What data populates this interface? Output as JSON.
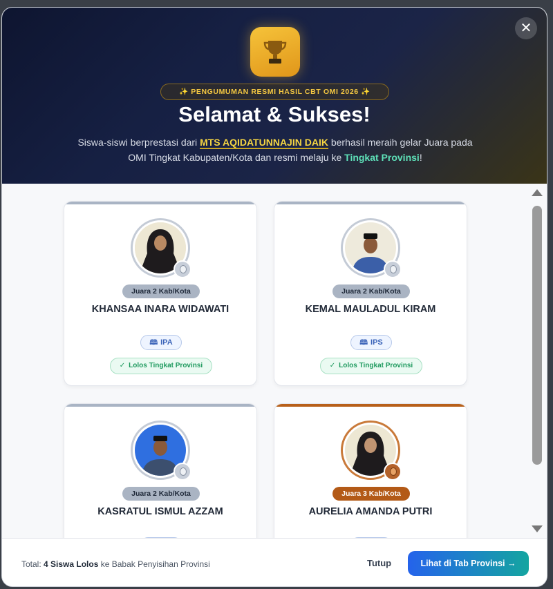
{
  "dialog": {
    "close_icon": "close-icon",
    "trophy_icon": "trophy-icon",
    "announcement": "✨ PENGUMUMAN RESMI HASIL CBT OMI 2026 ✨",
    "title": "Selamat & Sukses!",
    "description": {
      "part1": "Siswa-siswi berprestasi dari ",
      "school": "MTS AQIDATUNNAJIN DAIK",
      "part2": " berhasil meraih gelar Juara pada OMI Tingkat Kabupaten/Kota dan resmi melaju ke ",
      "level": "Tingkat Provinsi",
      "part3": "!"
    }
  },
  "students": [
    {
      "rank": "Juara 2 Kab/Kota",
      "name": "KHANSAA INARA WIDAWATI",
      "subject": "IPA",
      "status": "Lolos Tingkat Provinsi"
    },
    {
      "rank": "Juara 2 Kab/Kota",
      "name": "KEMAL MAULADUL KIRAM",
      "subject": "IPS",
      "status": "Lolos Tingkat Provinsi"
    },
    {
      "rank": "Juara 2 Kab/Kota",
      "name": "KASRATUL ISMUL AZZAM"
    },
    {
      "rank": "Juara 3 Kab/Kota",
      "name": "AURELIA AMANDA PUTRI"
    }
  ],
  "footer": {
    "total_label": "Total: ",
    "total_value": "4 Siswa Lolos",
    "total_suffix": " ke Babak Penyisihan Provinsi",
    "close_label": "Tutup",
    "cta_label": "Lihat di Tab Provinsi →"
  },
  "colors": {
    "silver": "#aab4c3",
    "bronze": "#b35a17",
    "accent_gold": "#f5c842",
    "accent_teal": "#5ee0b8",
    "cta_start": "#2563eb",
    "cta_end": "#14a5a0"
  }
}
